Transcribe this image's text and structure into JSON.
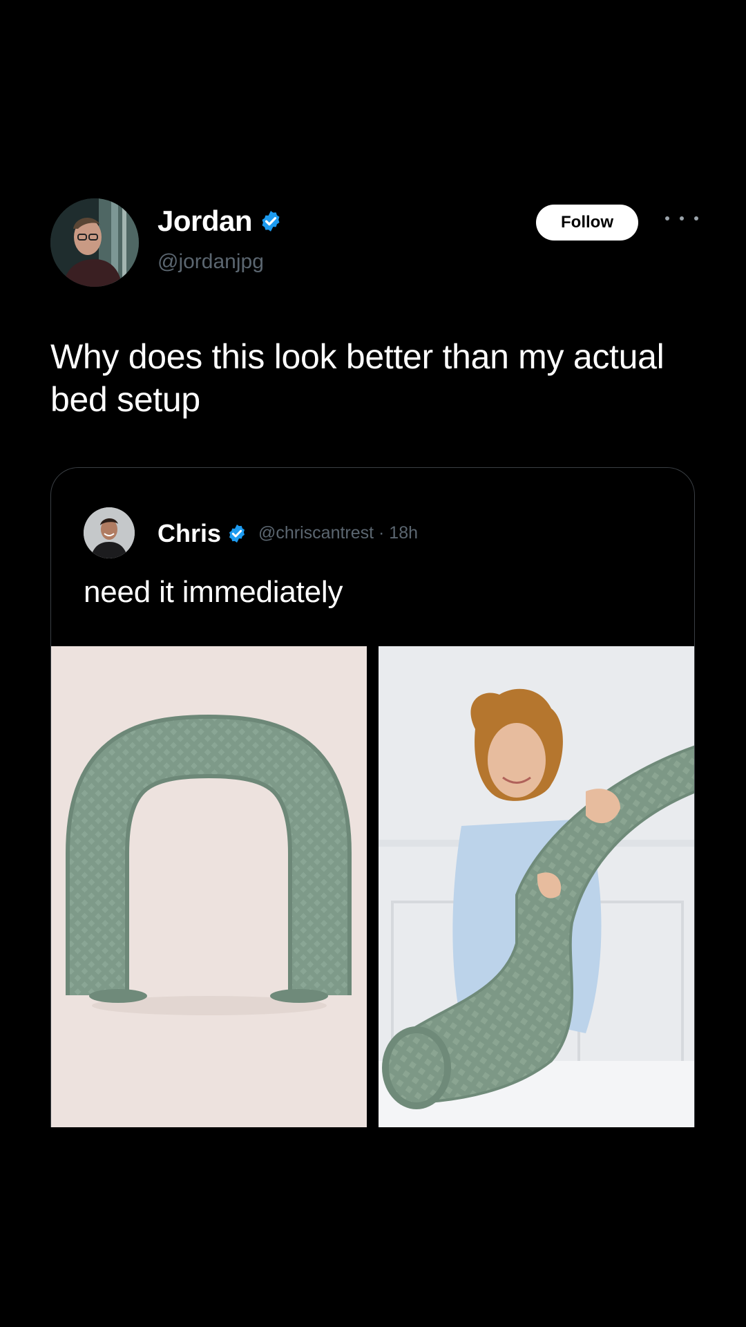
{
  "post": {
    "author_name": "Jordan",
    "author_handle": "@jordanjpg",
    "follow_label": "Follow",
    "text": "Why does this look better than my actual bed setup"
  },
  "quoted_post": {
    "author_name": "Chris",
    "meta": "@chriscantrest · 18h",
    "text": "need it immediately",
    "media": [
      {
        "description": "green U-shaped body pillow"
      },
      {
        "description": "woman hugging green body pillow"
      }
    ]
  },
  "colors": {
    "background": "#000000",
    "verified_badge": "#1d9bf0",
    "muted_text": "#5b6670",
    "pillow_green": "#7e9a89"
  }
}
